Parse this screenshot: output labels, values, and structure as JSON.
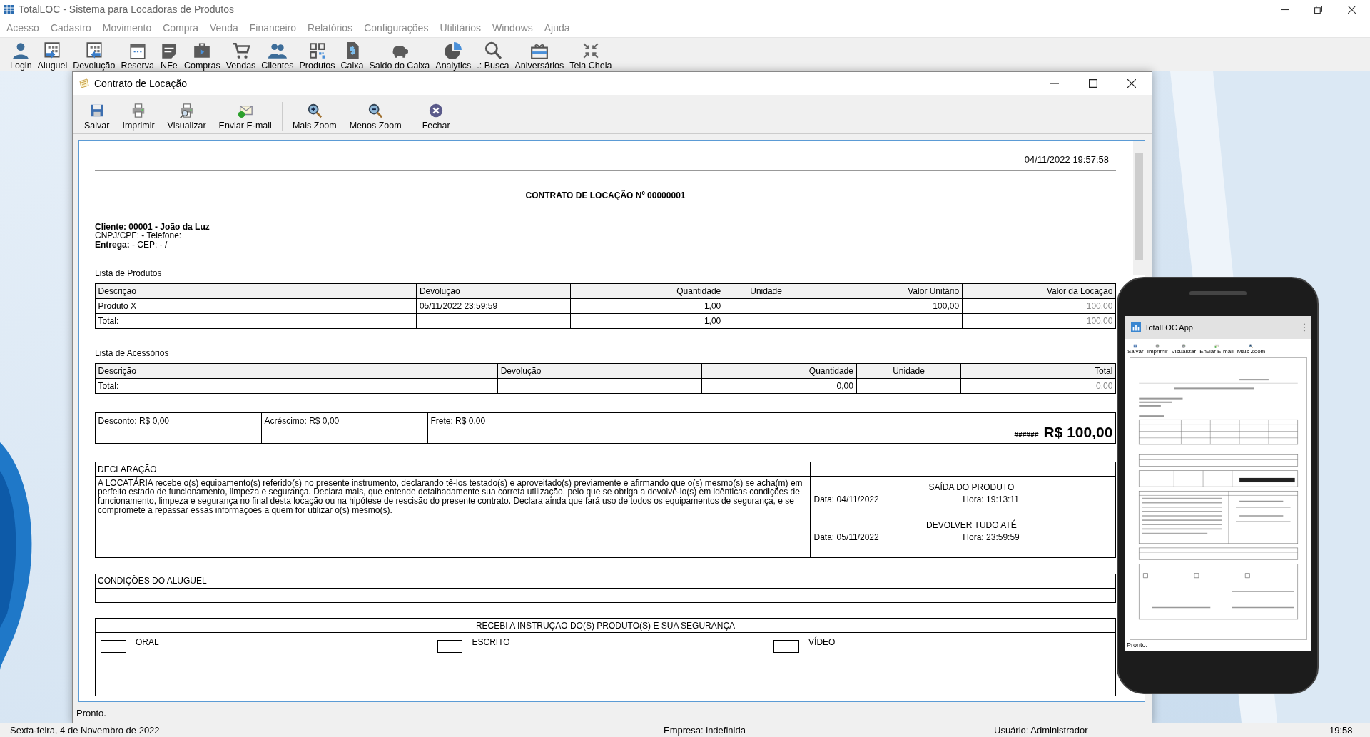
{
  "app": {
    "title": "TotalLOC - Sistema para Locadoras de Produtos"
  },
  "menu": [
    "Acesso",
    "Cadastro",
    "Movimento",
    "Compra",
    "Venda",
    "Financeiro",
    "Relatórios",
    "Configurações",
    "Utilitários",
    "Windows",
    "Ajuda"
  ],
  "toolbar": [
    "Login",
    "Aluguel",
    "Devolução",
    "Reserva",
    "NFe",
    "Compras",
    "Vendas",
    "Clientes",
    "Produtos",
    "Caixa",
    "Saldo do Caixa",
    "Analytics",
    ".: Busca",
    "Aniversários",
    "Tela Cheia"
  ],
  "child_window": {
    "title": "Contrato de Locação",
    "toolbar": [
      "Salvar",
      "Imprimir",
      "Visualizar",
      "Enviar E-mail",
      "Mais Zoom",
      "Menos Zoom",
      "Fechar"
    ],
    "document": {
      "timestamp": "04/11/2022 19:57:58",
      "title": "CONTRATO DE LOCAÇÃO Nº 00000001",
      "client_lines": [
        {
          "text": "Cliente: 00001 - João da Luz",
          "bold": true
        },
        {
          "text": "CNPJ/CPF: - Telefone:",
          "bold": false
        },
        {
          "text": "**Entrega:** - CEP: - /",
          "bold": false
        }
      ],
      "products": {
        "label": "Lista de Produtos",
        "columns": [
          "Descrição",
          "Devolução",
          "Quantidade",
          "Unidade",
          "Valor Unitário",
          "Valor da Locação"
        ],
        "rows": [
          [
            "Produto X",
            "05/11/2022 23:59:59",
            "1,00",
            null,
            "100,00",
            "100,00"
          ],
          [
            "Total:",
            null,
            "1,00",
            null,
            null,
            "100,00"
          ]
        ]
      },
      "accessories": {
        "label": "Lista de Acessórios",
        "columns": [
          "Descrição",
          "Devolução",
          "Quantidade",
          "Unidade",
          "Total"
        ],
        "rows": [
          [
            "Total:",
            null,
            "0,00",
            null,
            "0,00"
          ]
        ]
      },
      "summary": {
        "discount": "Desconto: R$ 0,00",
        "addition": "Acréscimo: R$ 0,00",
        "freight": "Frete: R$ 0,00",
        "hash": "######",
        "total": "R$ 100,00"
      },
      "declaration": {
        "heading": "DECLARAÇÃO",
        "text": "A LOCATÁRIA recebe o(s) equipamento(s) referido(s) no presente instrumento, declarando tê-los testado(s) e aproveitado(s) previamente e afirmando que o(s) mesmo(s) se acha(m) em perfeito estado de funcionamento, limpeza e segurança. Declara mais, que entende detalhadamente sua correta utilização, pelo que se obriga a devolvê-lo(s) em idênticas condições de funcionamento, limpeza e segurança no final desta locação ou na hipótese de rescisão do presente contrato. Declara ainda que fará uso de todos os equipamentos de segurança, e se compromete a repassar essas informações a quem for utilizar o(s) mesmo(s).",
        "pickup_heading": "SAÍDA DO PRODUTO",
        "pickup_date": "Data: 04/11/2022",
        "pickup_time": "Hora: 19:13:11",
        "return_heading": "DEVOLVER TUDO ATÉ",
        "return_date": "Data: 05/11/2022",
        "return_time": "Hora: 23:59:59"
      },
      "conditions": {
        "heading": "CONDIÇÕES DO ALUGUEL"
      },
      "instruction": {
        "heading": "RECEBI A INSTRUÇÃO DO(S) PRODUTO(S) E SUA SEGURANÇA",
        "options": [
          {
            "label": "ORAL",
            "checked": false
          },
          {
            "label": "ESCRITO",
            "checked": false
          },
          {
            "label": "VÍDEO",
            "checked": false
          }
        ]
      }
    },
    "status": "Pronto."
  },
  "phone": {
    "app_title": "TotalLOC App",
    "toolbar": [
      "Salvar",
      "Imprimir",
      "Visualizar",
      "Enviar E-mail",
      "Mais Zoom"
    ],
    "status": "Pronto."
  },
  "status_bar": {
    "date": "Sexta-feira, 4 de Novembro de 2022",
    "company": "Empresa: indefinida",
    "user": "Usuário: Administrador",
    "clock": "19:58"
  }
}
